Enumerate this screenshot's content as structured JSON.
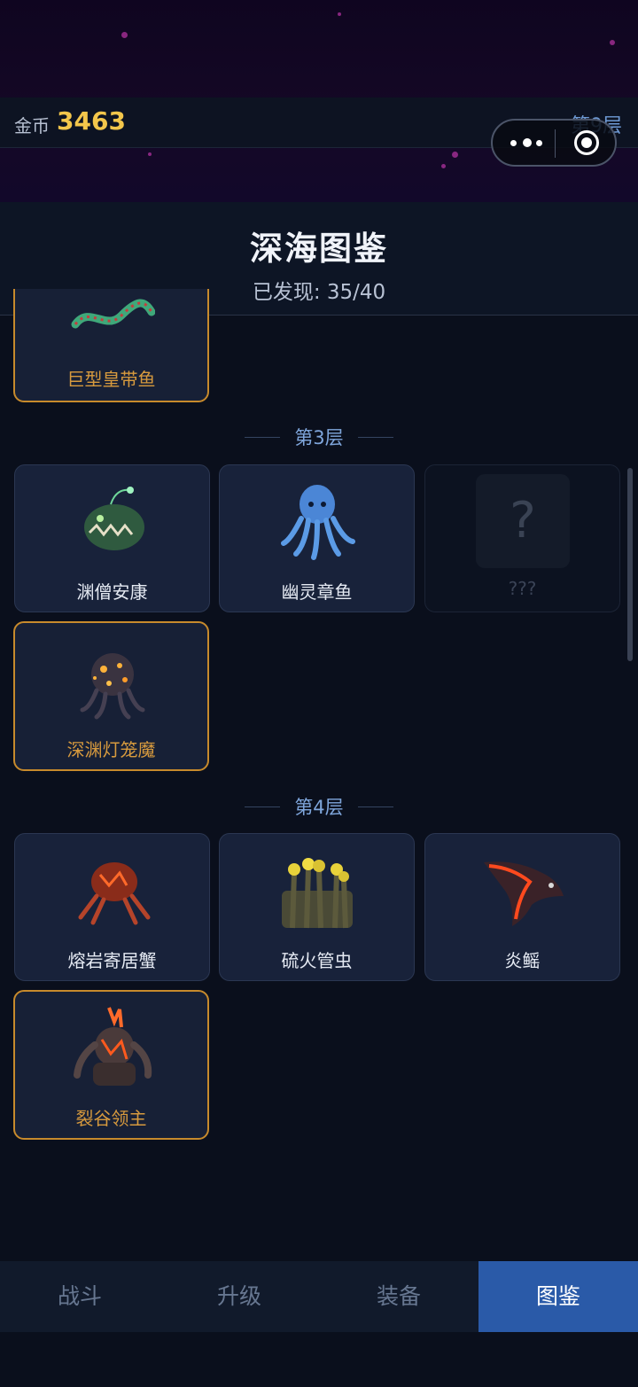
{
  "hud": {
    "coin_label": "金币",
    "coin_value": "3463",
    "floor_label": "第9层"
  },
  "header": {
    "title": "深海图鉴",
    "discovered": "已发现: 35/40"
  },
  "sections": [
    {
      "label": "第3层"
    },
    {
      "label": "第4层"
    }
  ],
  "creatures": [
    {
      "name": "巨型皇带鱼",
      "status": "boss",
      "icon": "oarfish-icon"
    },
    {
      "name": "渊僧安康",
      "status": "found",
      "icon": "anglerfish-icon"
    },
    {
      "name": "幽灵章鱼",
      "status": "found",
      "icon": "octopus-icon"
    },
    {
      "name": "???",
      "status": "locked",
      "icon": "question-icon"
    },
    {
      "name": "深渊灯笼魔",
      "status": "boss",
      "icon": "lantern-demon-icon"
    },
    {
      "name": "熔岩寄居蟹",
      "status": "found",
      "icon": "hermit-crab-icon"
    },
    {
      "name": "硫火管虫",
      "status": "found",
      "icon": "tube-worm-icon"
    },
    {
      "name": "炎鳐",
      "status": "found",
      "icon": "manta-ray-icon"
    },
    {
      "name": "裂谷领主",
      "status": "boss",
      "icon": "rift-lord-icon"
    }
  ],
  "locked_symbol": "?",
  "tabs": [
    {
      "label": "战斗"
    },
    {
      "label": "升级"
    },
    {
      "label": "装备"
    },
    {
      "label": "图鉴",
      "active": true
    }
  ],
  "colors": {
    "coin": "#f3c64b",
    "boss_border": "#c78a2c",
    "active_tab": "#2a5aa8",
    "section_label": "#7fa6dc"
  }
}
